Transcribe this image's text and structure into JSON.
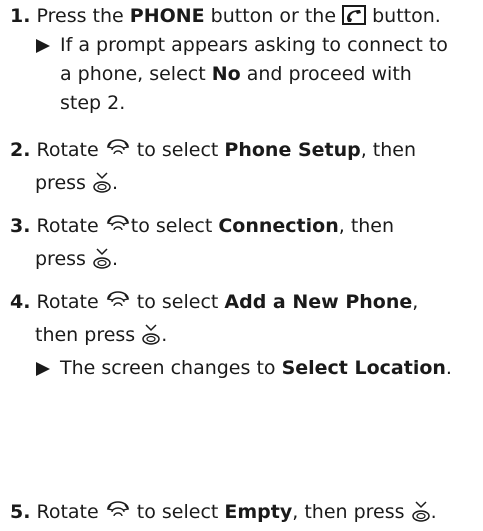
{
  "step1": {
    "num": "1.",
    "t1": " Press the ",
    "b1": "PHONE",
    "t2": " button or the ",
    "t3": " button.",
    "sub_a": "If a prompt appears asking to connect to",
    "sub_b1": "a phone, select ",
    "sub_b2": "No",
    "sub_b3": " and proceed with",
    "sub_c": "step 2."
  },
  "step2": {
    "num": "2.",
    "t1": " Rotate ",
    "t2": " to select ",
    "b1": "Phone Setup",
    "t3": ", then",
    "t4": "press ",
    "t5": "."
  },
  "step3": {
    "num": "3.",
    "t1": " Rotate ",
    "t2": "to select ",
    "b1": "Connection",
    "t3": ", then",
    "t4": "press ",
    "t5": "."
  },
  "step4": {
    "num": "4.",
    "t1": " Rotate ",
    "t2": " to select ",
    "b1": "Add a New Phone",
    "t3": ",",
    "t4": "then press ",
    "t5": ".",
    "sub_a1": "The screen changes to ",
    "sub_a2": "Select Location",
    "sub_a3": "."
  },
  "step5": {
    "num": "5.",
    "t1": " Rotate ",
    "t2": " to select ",
    "b1": "Empty",
    "t3": ", then press ",
    "t4": "."
  },
  "icons": {
    "phone_button": "phone-handset-button-icon",
    "selector_knob": "interface-selector-rotate-icon",
    "selector_press": "interface-selector-press-icon"
  }
}
